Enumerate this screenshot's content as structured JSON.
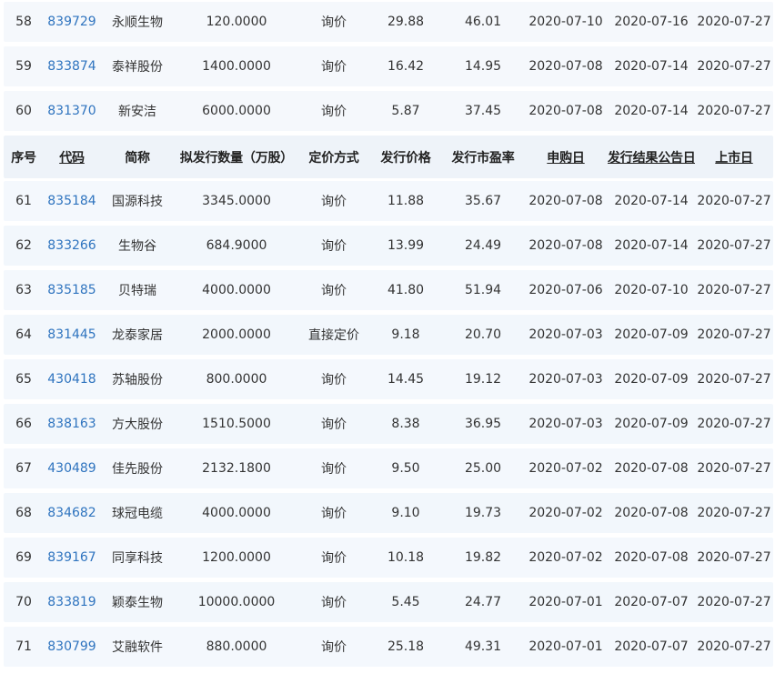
{
  "columns": [
    {
      "label": "序号",
      "sortable": false
    },
    {
      "label": "代码",
      "sortable": true
    },
    {
      "label": "简称",
      "sortable": false
    },
    {
      "label": "拟发行数量（万股）",
      "sortable": false
    },
    {
      "label": "定价方式",
      "sortable": false
    },
    {
      "label": "发行价格",
      "sortable": false
    },
    {
      "label": "发行市盈率",
      "sortable": false
    },
    {
      "label": "申购日",
      "sortable": true
    },
    {
      "label": "发行结果公告日",
      "sortable": true
    },
    {
      "label": "上市日",
      "sortable": true
    }
  ],
  "rows_before_header": [
    {
      "seq": "58",
      "code": "839729",
      "name": "永顺生物",
      "qty": "120.0000",
      "method": "询价",
      "price": "29.88",
      "pe": "46.01",
      "sub_date": "2020-07-10",
      "result_date": "2020-07-16",
      "list_date": "2020-07-27"
    },
    {
      "seq": "59",
      "code": "833874",
      "name": "泰祥股份",
      "qty": "1400.0000",
      "method": "询价",
      "price": "16.42",
      "pe": "14.95",
      "sub_date": "2020-07-08",
      "result_date": "2020-07-14",
      "list_date": "2020-07-27"
    },
    {
      "seq": "60",
      "code": "831370",
      "name": "新安洁",
      "qty": "6000.0000",
      "method": "询价",
      "price": "5.87",
      "pe": "37.45",
      "sub_date": "2020-07-08",
      "result_date": "2020-07-14",
      "list_date": "2020-07-27"
    }
  ],
  "rows_after_header": [
    {
      "seq": "61",
      "code": "835184",
      "name": "国源科技",
      "qty": "3345.0000",
      "method": "询价",
      "price": "11.88",
      "pe": "35.67",
      "sub_date": "2020-07-08",
      "result_date": "2020-07-14",
      "list_date": "2020-07-27"
    },
    {
      "seq": "62",
      "code": "833266",
      "name": "生物谷",
      "qty": "684.9000",
      "method": "询价",
      "price": "13.99",
      "pe": "24.49",
      "sub_date": "2020-07-08",
      "result_date": "2020-07-14",
      "list_date": "2020-07-27"
    },
    {
      "seq": "63",
      "code": "835185",
      "name": "贝特瑞",
      "qty": "4000.0000",
      "method": "询价",
      "price": "41.80",
      "pe": "51.94",
      "sub_date": "2020-07-06",
      "result_date": "2020-07-10",
      "list_date": "2020-07-27"
    },
    {
      "seq": "64",
      "code": "831445",
      "name": "龙泰家居",
      "qty": "2000.0000",
      "method": "直接定价",
      "price": "9.18",
      "pe": "20.70",
      "sub_date": "2020-07-03",
      "result_date": "2020-07-09",
      "list_date": "2020-07-27"
    },
    {
      "seq": "65",
      "code": "430418",
      "name": "苏轴股份",
      "qty": "800.0000",
      "method": "询价",
      "price": "14.45",
      "pe": "19.12",
      "sub_date": "2020-07-03",
      "result_date": "2020-07-09",
      "list_date": "2020-07-27"
    },
    {
      "seq": "66",
      "code": "838163",
      "name": "方大股份",
      "qty": "1510.5000",
      "method": "询价",
      "price": "8.38",
      "pe": "36.95",
      "sub_date": "2020-07-03",
      "result_date": "2020-07-09",
      "list_date": "2020-07-27"
    },
    {
      "seq": "67",
      "code": "430489",
      "name": "佳先股份",
      "qty": "2132.1800",
      "method": "询价",
      "price": "9.50",
      "pe": "25.00",
      "sub_date": "2020-07-02",
      "result_date": "2020-07-08",
      "list_date": "2020-07-27"
    },
    {
      "seq": "68",
      "code": "834682",
      "name": "球冠电缆",
      "qty": "4000.0000",
      "method": "询价",
      "price": "9.10",
      "pe": "19.73",
      "sub_date": "2020-07-02",
      "result_date": "2020-07-08",
      "list_date": "2020-07-27"
    },
    {
      "seq": "69",
      "code": "839167",
      "name": "同享科技",
      "qty": "1200.0000",
      "method": "询价",
      "price": "10.18",
      "pe": "19.82",
      "sub_date": "2020-07-02",
      "result_date": "2020-07-08",
      "list_date": "2020-07-27"
    },
    {
      "seq": "70",
      "code": "833819",
      "name": "颖泰生物",
      "qty": "10000.0000",
      "method": "询价",
      "price": "5.45",
      "pe": "24.77",
      "sub_date": "2020-07-01",
      "result_date": "2020-07-07",
      "list_date": "2020-07-27"
    },
    {
      "seq": "71",
      "code": "830799",
      "name": "艾融软件",
      "qty": "880.0000",
      "method": "询价",
      "price": "25.18",
      "pe": "49.31",
      "sub_date": "2020-07-01",
      "result_date": "2020-07-07",
      "list_date": "2020-07-27"
    }
  ],
  "colors": {
    "link": "#2f74bf",
    "row_bg": "#f4f8fd",
    "header_bg": "#eef3f9",
    "text": "#333333"
  }
}
